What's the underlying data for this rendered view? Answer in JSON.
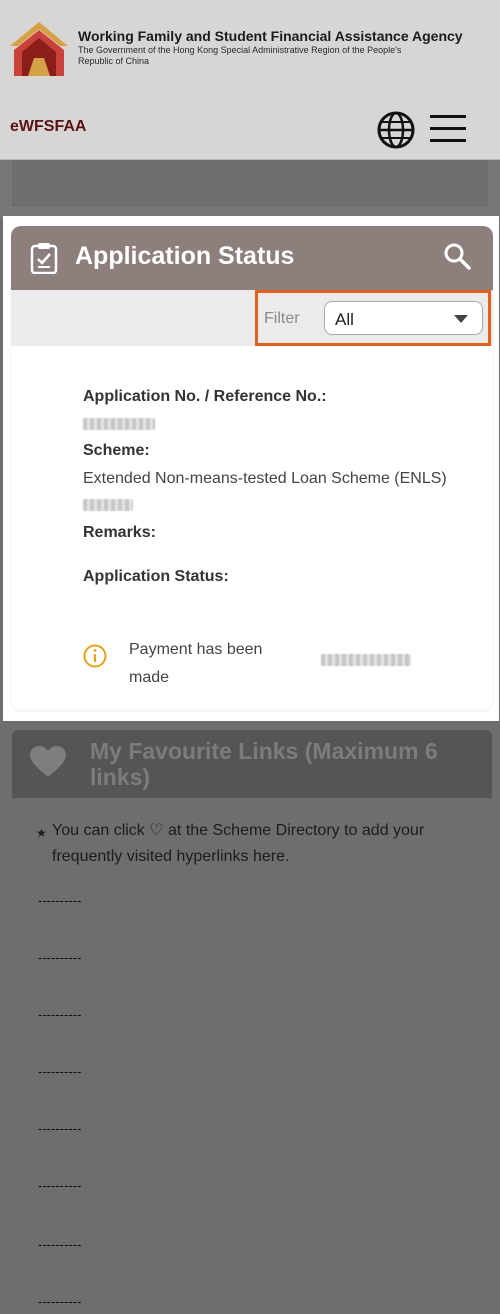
{
  "header": {
    "agency_name": "Working Family and Student Financial Assistance Agency",
    "agency_sub": "The Government of the Hong Kong Special Administrative Region of the People's Republic of China",
    "brand": "eWFSFAA"
  },
  "status_card": {
    "title": "Application Status",
    "filter_label": "Filter",
    "filter_value": "All",
    "application_no_label": "Application No. / Reference No.:",
    "scheme_label": "Scheme:",
    "scheme_value": "Extended Non-means-tested Loan Scheme (ENLS)",
    "remarks_label": "Remarks:",
    "status_label": "Application Status:",
    "status_value": "Payment has been made"
  },
  "favourites": {
    "title": "My Favourite Links (Maximum 6 links)",
    "note": "You can click ♡ at the Scheme Directory to add your frequently visited hyperlinks here.",
    "placeholders": [
      "----------",
      "----------",
      "----------",
      "----------",
      "----------",
      "----------",
      "----------",
      "----------"
    ]
  },
  "colors": {
    "card_header": "#8d7f7b",
    "filter_highlight": "#e0601c",
    "info_icon": "#e8a317",
    "brand": "#5a1212",
    "overlay": "#6e6e6e"
  },
  "icons": [
    "agency-logo-icon",
    "globe-icon",
    "menu-icon",
    "clipboard-icon",
    "search-icon",
    "caret-down-icon",
    "info-icon",
    "heart-icon"
  ]
}
